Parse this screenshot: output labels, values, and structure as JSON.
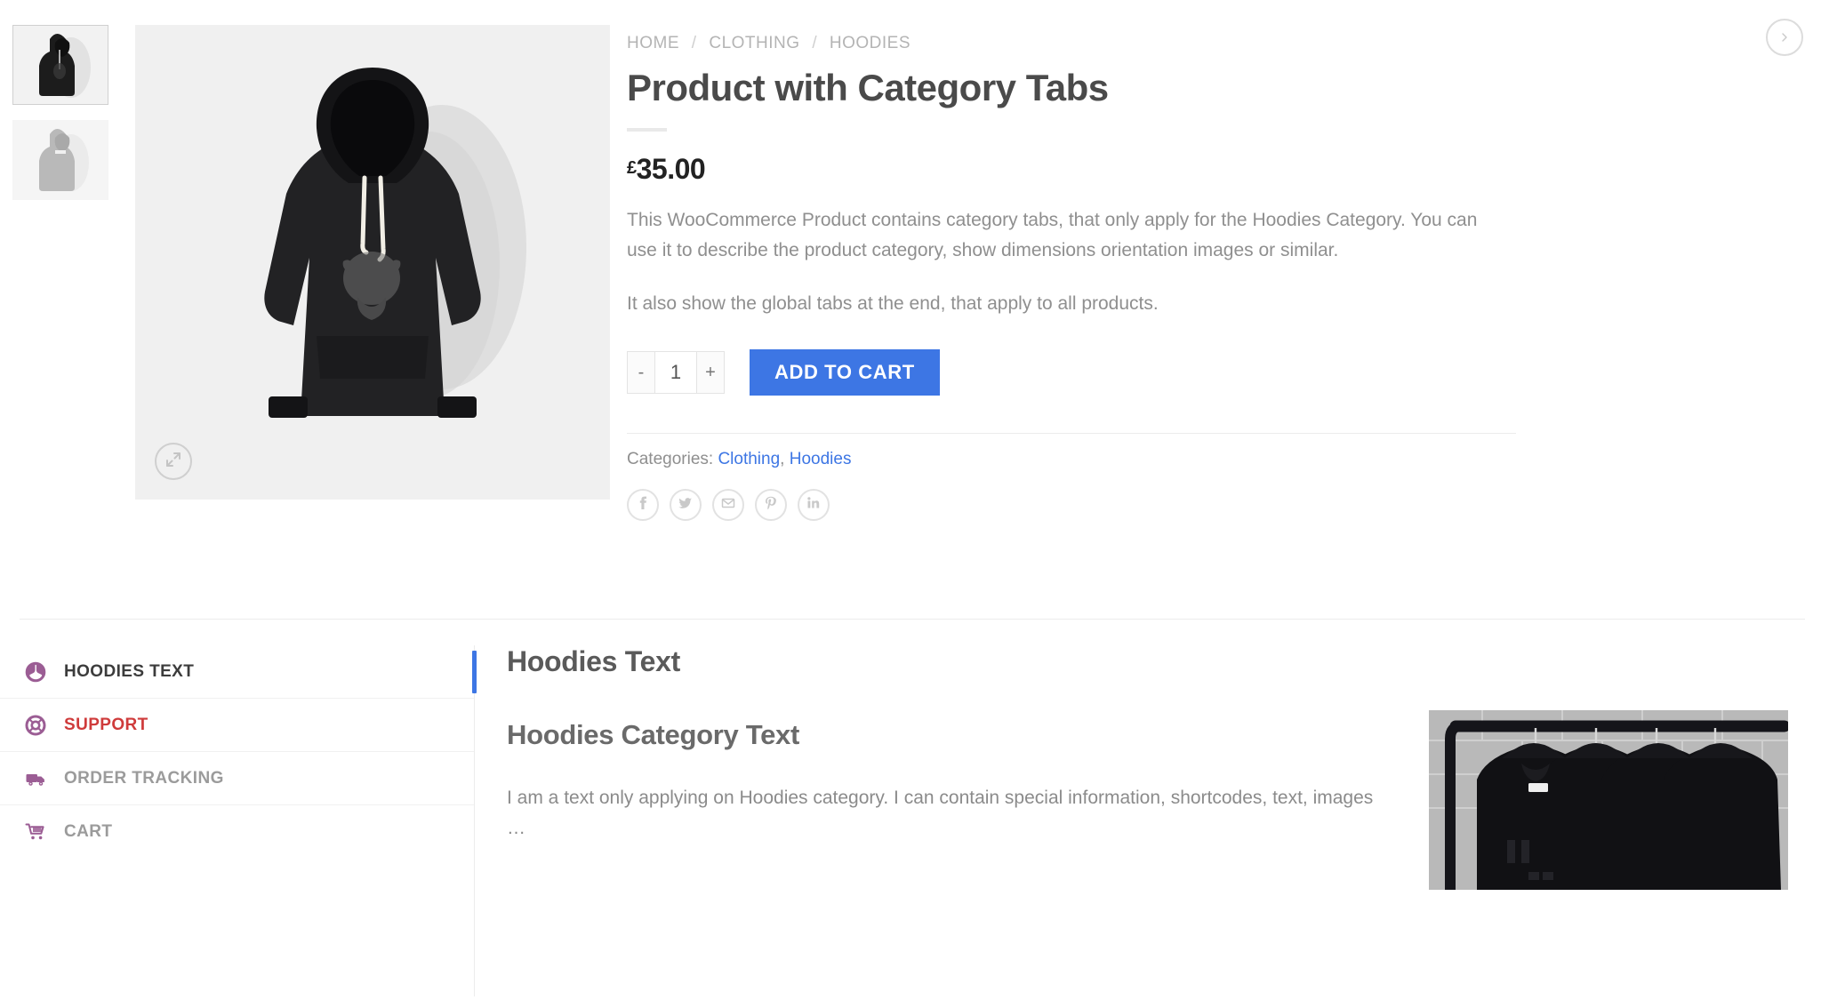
{
  "nav": {
    "next_product_label": "Next product",
    "next_icon": "chevron-right-icon"
  },
  "gallery": {
    "thumbnails": [
      {
        "alt": "Black hoodie front view",
        "selected": true
      },
      {
        "alt": "Gray hoodie back view",
        "selected": false
      }
    ],
    "main_image_alt": "Black hoodie with drawstrings on light gray background",
    "zoom_label": "Zoom image",
    "zoom_icon": "expand-icon"
  },
  "breadcrumb": {
    "items": [
      {
        "label": "HOME"
      },
      {
        "label": "CLOTHING"
      },
      {
        "label": "HOODIES"
      }
    ],
    "separator": "/"
  },
  "product": {
    "title": "Product with Category Tabs",
    "currency_symbol": "£",
    "price": "35.00",
    "description_1": "This WooCommerce Product contains category tabs, that only apply for the Hoodies Category. You can use it to describe the product category, show dimensions orientation images or similar.",
    "description_2": "It also show the global tabs at the end, that apply to all products."
  },
  "cart": {
    "decrease_label": "-",
    "quantity": "1",
    "increase_label": "+",
    "add_to_cart_label": "ADD TO CART",
    "accent_color": "#3d76e4"
  },
  "meta": {
    "categories_label": "Categories:",
    "categories": [
      {
        "label": "Clothing"
      },
      {
        "label": "Hoodies"
      }
    ],
    "category_separator": ", "
  },
  "share": {
    "buttons": [
      {
        "icon": "facebook-icon",
        "label": "Share on Facebook"
      },
      {
        "icon": "twitter-icon",
        "label": "Share on Twitter"
      },
      {
        "icon": "email-icon",
        "label": "Share by Email"
      },
      {
        "icon": "pinterest-icon",
        "label": "Share on Pinterest"
      },
      {
        "icon": "linkedin-icon",
        "label": "Share on LinkedIn"
      }
    ]
  },
  "tabs": {
    "items": [
      {
        "label": "HOODIES TEXT",
        "icon": "rebel-emblem-icon",
        "state": "active"
      },
      {
        "label": "SUPPORT",
        "icon": "lifebuoy-icon",
        "state": "hover"
      },
      {
        "label": "ORDER TRACKING",
        "icon": "delivery-truck-icon",
        "state": "default"
      },
      {
        "label": "CART",
        "icon": "shopping-cart-icon",
        "state": "default"
      }
    ],
    "icon_color": "#9b5d94",
    "active_indicator_color": "#3d76e4",
    "hover_text_color": "#cf3b3b"
  },
  "panel": {
    "heading": "Hoodies Text",
    "subheading": "Hoodies Category Text",
    "body": "I am a text only applying on Hoodies category. I can contain special information, shortcodes, text, images …",
    "figure_alt": "Black sweatshirts hanging on a clothing rack against a brick wall"
  }
}
